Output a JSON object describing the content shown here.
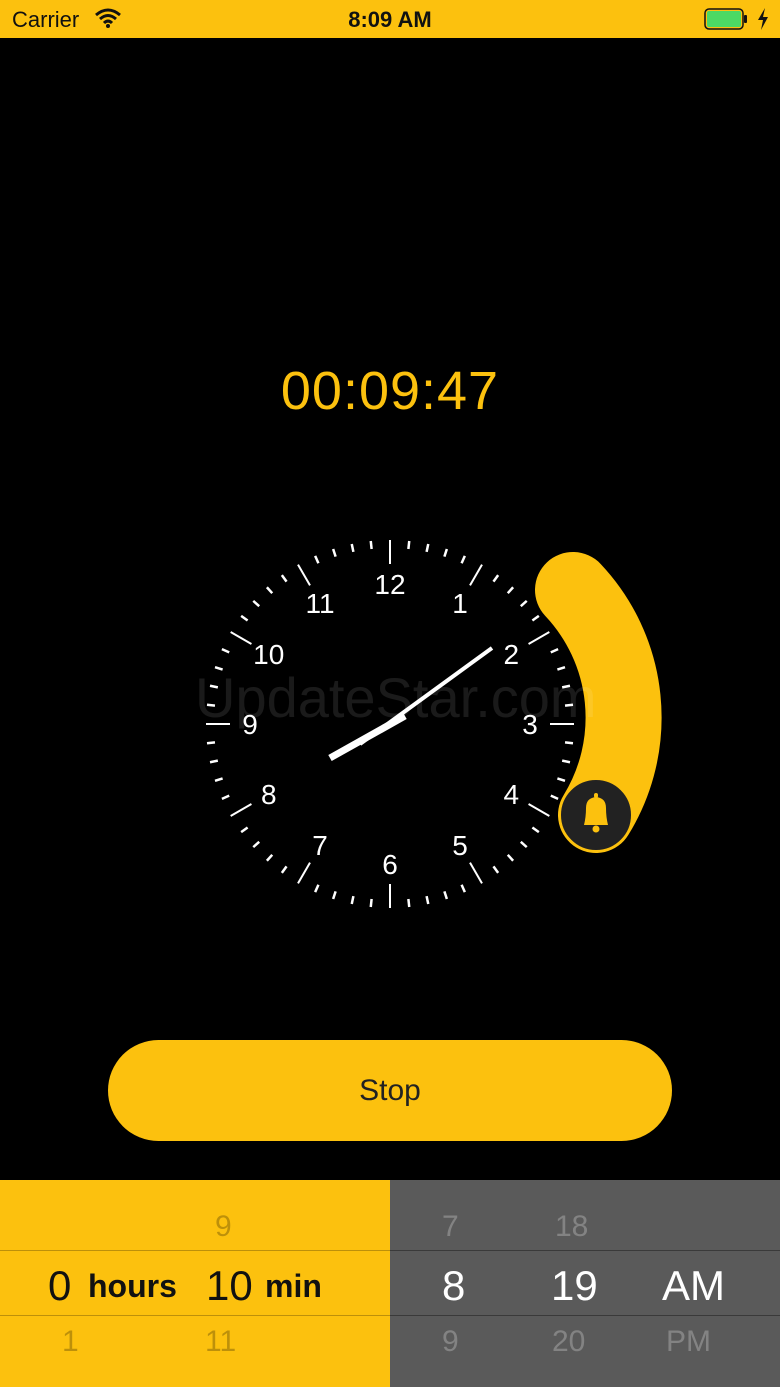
{
  "status_bar": {
    "carrier": "Carrier",
    "time": "8:09 AM"
  },
  "timer": {
    "countdown": "00:09:47"
  },
  "clock": {
    "numbers": [
      "12",
      "1",
      "2",
      "3",
      "4",
      "5",
      "6",
      "7",
      "8",
      "9",
      "10",
      "11"
    ],
    "hands": {
      "hour": 8,
      "minute": 10
    },
    "alarm_icon": "bell-icon"
  },
  "watermark": "UpdateStar.com",
  "actions": {
    "stop_label": "Stop"
  },
  "duration_picker": {
    "hours": {
      "above": "",
      "selected": "0",
      "below": "1",
      "unit": "hours"
    },
    "minutes": {
      "above": "9",
      "selected": "10",
      "below": "11",
      "unit": "min"
    }
  },
  "time_picker": {
    "hour": {
      "above": "7",
      "selected": "8",
      "below": "9"
    },
    "minute": {
      "above": "18",
      "selected": "19",
      "below": "20"
    },
    "period": {
      "above": "",
      "selected": "AM",
      "below": "PM"
    }
  },
  "colors": {
    "accent": "#fcc10e",
    "background": "#000000",
    "picker_right": "#5a5a5a"
  }
}
